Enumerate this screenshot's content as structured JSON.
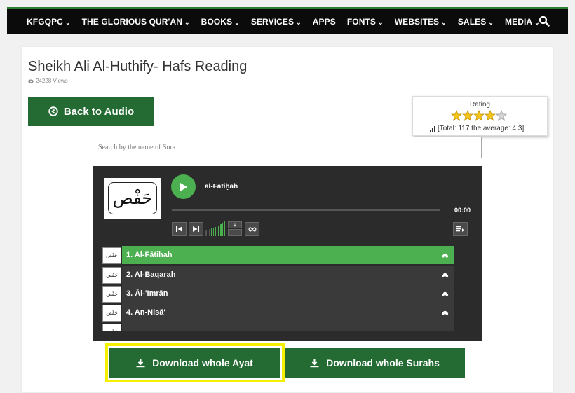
{
  "nav": {
    "items": [
      {
        "label": "KFGQPC",
        "dropdown": true
      },
      {
        "label": "THE GLORIOUS QUR'AN",
        "dropdown": true
      },
      {
        "label": "BOOKS",
        "dropdown": true
      },
      {
        "label": "SERVICES",
        "dropdown": true
      },
      {
        "label": "APPS",
        "dropdown": false
      },
      {
        "label": "FONTS",
        "dropdown": true
      },
      {
        "label": "WEBSITES",
        "dropdown": true
      },
      {
        "label": "SALES",
        "dropdown": true
      },
      {
        "label": "MEDIA",
        "dropdown": true
      }
    ],
    "search_icon": "search-icon"
  },
  "page": {
    "title": "Sheikh Ali Al-Huthify- Hafs Reading",
    "views": "24228 Views",
    "back_button": "Back to Audio"
  },
  "rating": {
    "label": "Rating",
    "stars_filled": 4.3,
    "stars_max": 5,
    "stats": "[Total: 117 the average: 4.3]"
  },
  "search": {
    "placeholder": "Search by the name of Sura",
    "value": ""
  },
  "player": {
    "artwork_text": "حَفْص",
    "current_track": "al-Fātiḥah",
    "time": "00:00",
    "progress": 0,
    "volume": 0.6
  },
  "playlist": [
    {
      "label": "1. Al-Fātiḥah",
      "thumb": "حَفْص",
      "active": true
    },
    {
      "label": "2. Al-Baqarah",
      "thumb": "حَفْص",
      "active": false
    },
    {
      "label": "3. Āl-'Imrān",
      "thumb": "حَفْص",
      "active": false
    },
    {
      "label": "4. An-Nisā'",
      "thumb": "حَفْص",
      "active": false
    },
    {
      "label": "",
      "thumb": "حَفْص",
      "active": false
    }
  ],
  "downloads": {
    "ayat": "Download whole Ayat",
    "surahs": "Download whole Surahs"
  },
  "colors": {
    "accent_green": "#4caf50",
    "button_green": "#236b32",
    "highlight": "#f5ef00"
  }
}
